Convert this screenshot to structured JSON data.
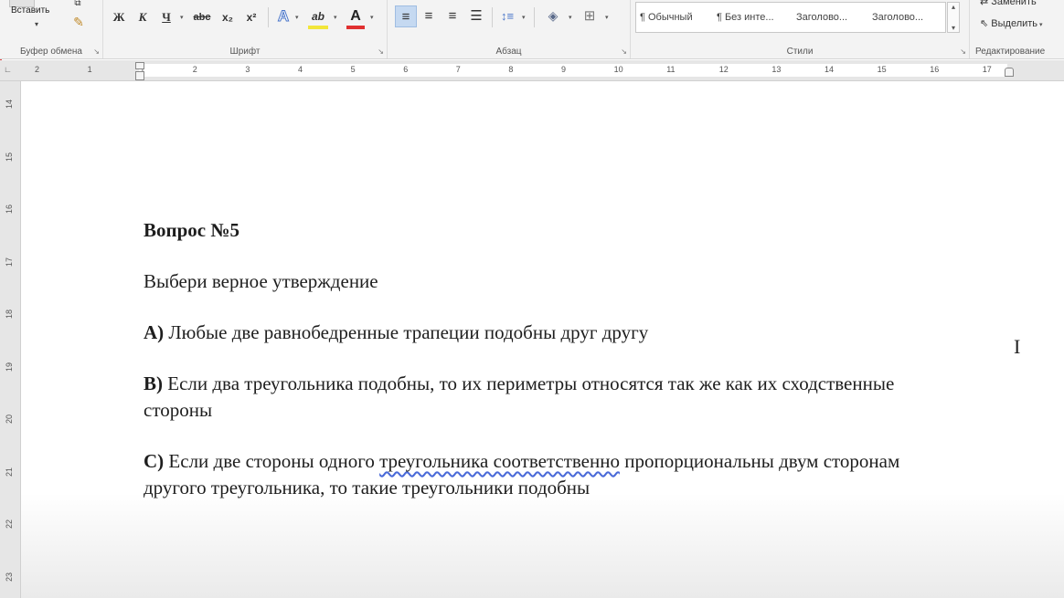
{
  "ribbon": {
    "clipboard": {
      "paste_label": "Вставить",
      "group_label": "Буфер обмена"
    },
    "font": {
      "group_label": "Шрифт",
      "bold": "Ж",
      "italic": "К",
      "underline": "Ч",
      "strike": "abc",
      "subscript": "x₂",
      "superscript": "x²",
      "text_effects": "A",
      "highlight": "ab",
      "font_color": "A"
    },
    "paragraph": {
      "group_label": "Абзац"
    },
    "styles": {
      "group_label": "Стили",
      "items": [
        "¶ Обычный",
        "¶ Без инте...",
        "Заголово...",
        "Заголово..."
      ]
    },
    "editing": {
      "group_label": "Редактирование",
      "replace": "Заменить",
      "select": "Выделить"
    }
  },
  "ruler": {
    "h_numbers": [
      "2",
      "1",
      "1",
      "2",
      "3",
      "4",
      "5",
      "6",
      "7",
      "8",
      "9",
      "10",
      "11",
      "12",
      "13",
      "14",
      "15",
      "16",
      "17"
    ],
    "v_numbers": [
      "14",
      "15",
      "16",
      "17",
      "18",
      "19",
      "20",
      "21",
      "22",
      "23"
    ]
  },
  "document": {
    "title": "Вопрос №5",
    "prompt": "Выбери верное утверждение",
    "option_a": {
      "label": "A)",
      "text": " Любые две равнобедренные трапеции подобны друг другу"
    },
    "option_b": {
      "label": "B)",
      "text": " Если два треугольника подобны, то их периметры относятся так же как их сходственные стороны"
    },
    "option_c": {
      "label": "C)",
      "text_before": " Если две стороны одного ",
      "text_underlined": "треугольника  соответственно",
      "text_after": " пропорциональны двум сторонам другого треугольника, то такие треугольники подобны"
    }
  }
}
